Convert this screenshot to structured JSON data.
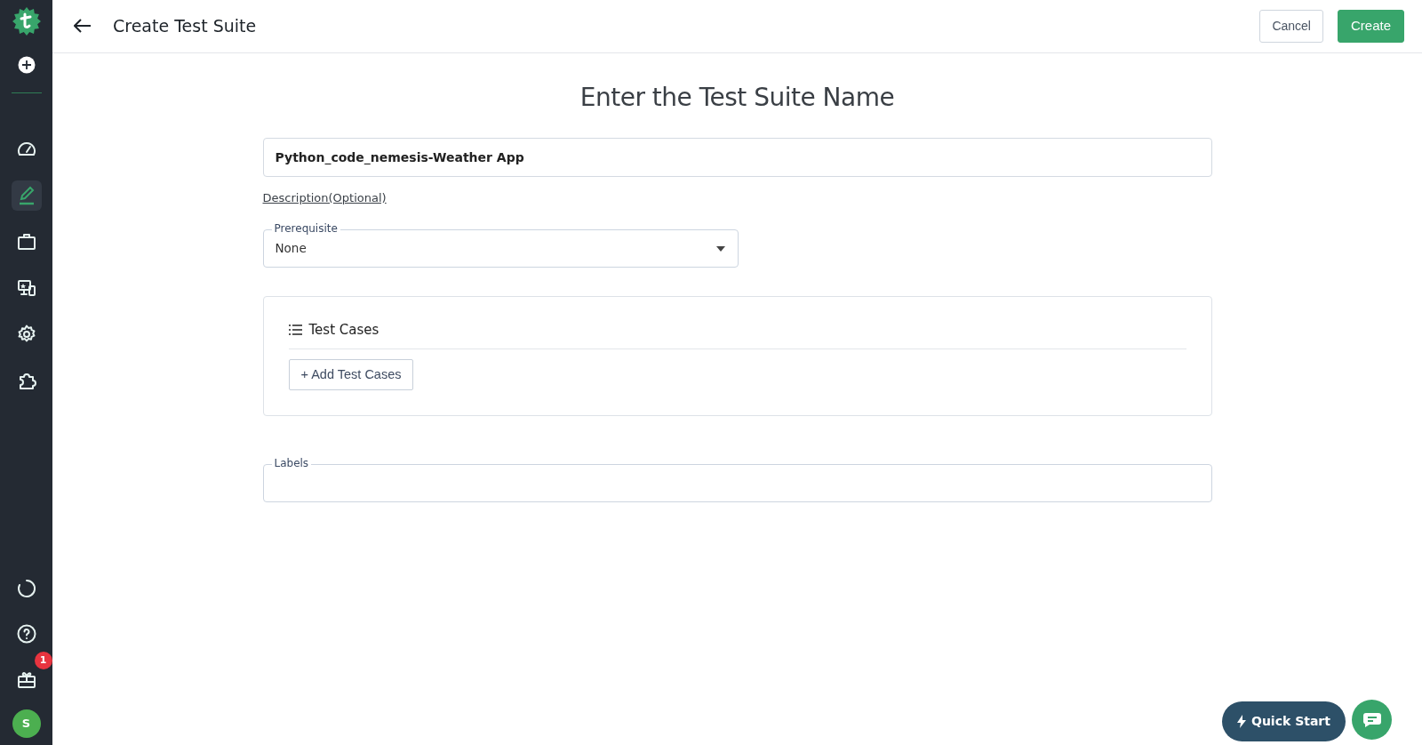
{
  "sidebar": {
    "avatar": "S",
    "top_items": [
      {
        "kind": "add"
      }
    ],
    "nav_items": [
      {
        "kind": "dashboard",
        "selected": false
      },
      {
        "kind": "edit",
        "selected": true
      },
      {
        "kind": "briefcase",
        "selected": false
      },
      {
        "kind": "devices",
        "selected": false
      },
      {
        "kind": "settings",
        "selected": false
      },
      {
        "kind": "puzzle",
        "selected": false
      }
    ],
    "bottom_items": [
      {
        "kind": "loader"
      },
      {
        "kind": "help"
      },
      {
        "kind": "gift",
        "badge": "1"
      }
    ]
  },
  "header": {
    "title": "Create Test Suite",
    "buttons": [
      {
        "label": "Cancel",
        "kind": "secondary"
      },
      {
        "label": "Create",
        "kind": "primary"
      }
    ]
  },
  "form": {
    "heading": "Enter the Test Suite Name",
    "name_field": {
      "value": "Python_code_nemesis-Weather App"
    },
    "description_link": "Description(Optional)",
    "prerequisite": {
      "label": "Prerequisite",
      "value": "None"
    },
    "test_cases": {
      "title": "Test Cases",
      "add_button": "+ Add Test Cases"
    },
    "labels": {
      "label": "Labels"
    }
  },
  "quick_start": {
    "label": "Quick Start"
  }
}
